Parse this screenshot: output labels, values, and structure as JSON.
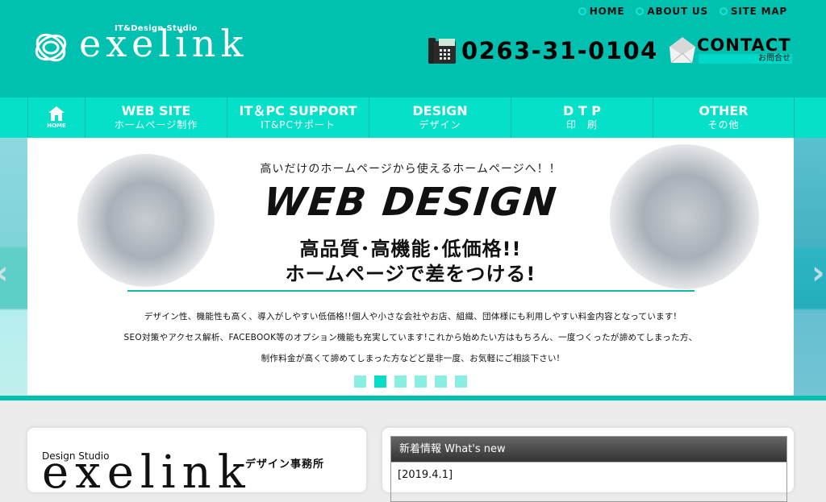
{
  "header": {
    "logo_tagline": "IT&Design Studio",
    "logo_word": "exelink",
    "top_links": [
      {
        "label": "HOME"
      },
      {
        "label": "ABOUT US"
      },
      {
        "label": "SITE MAP"
      }
    ],
    "phone_number": "0263-31-0104",
    "contact": {
      "label": "CONTACT",
      "sub_label": "お問合せ"
    }
  },
  "main_nav": {
    "home_label": "HOME",
    "items": [
      {
        "en": "WEB SITE",
        "jp": "ホームページ制作"
      },
      {
        "en": "IT＆PC SUPPORT",
        "jp": "IT&PCサポート"
      },
      {
        "en": "DESIGN",
        "jp": "デザイン"
      },
      {
        "en": "D T P",
        "jp": "印　刷"
      },
      {
        "en": "OTHER",
        "jp": "その他"
      }
    ]
  },
  "hero": {
    "tagline": "高いだけのホームページから使えるホームページへ！！",
    "title": "WEB DESIGN",
    "headline_1": "高品質･高機能･低価格!!",
    "headline_2": "ホームページで差をつける!",
    "description": [
      "デザイン性、機能性も高く、導入がしやすい低価格!!個人や小さな会社やお店、組織、団体様にも利用しやすい料金内容となっています!",
      "SEO対策やアクセス解析、FACEBOOK等のオプション機能も充実しています!これから始めたい方はもちろん、一度つくったが諦めてしまった方、",
      "制作料金が高くて諦めてしまった方などど是非一度、お気軽にご相談下さい!"
    ],
    "slide_count": 6,
    "active_slide": 2,
    "prev_arrow": "‹",
    "next_arrow": "›"
  },
  "studio_card": {
    "label": "Design Studio",
    "word": "exelink",
    "jp": "デザイン事務所"
  },
  "news": {
    "title": "新着情報  What's new",
    "first_date": "[2019.4.1]"
  },
  "colors": {
    "brand": "#00c0b0",
    "nav": "#05e0c8",
    "dot_active": "#05ddc8",
    "dot_inactive": "#88efe2"
  }
}
